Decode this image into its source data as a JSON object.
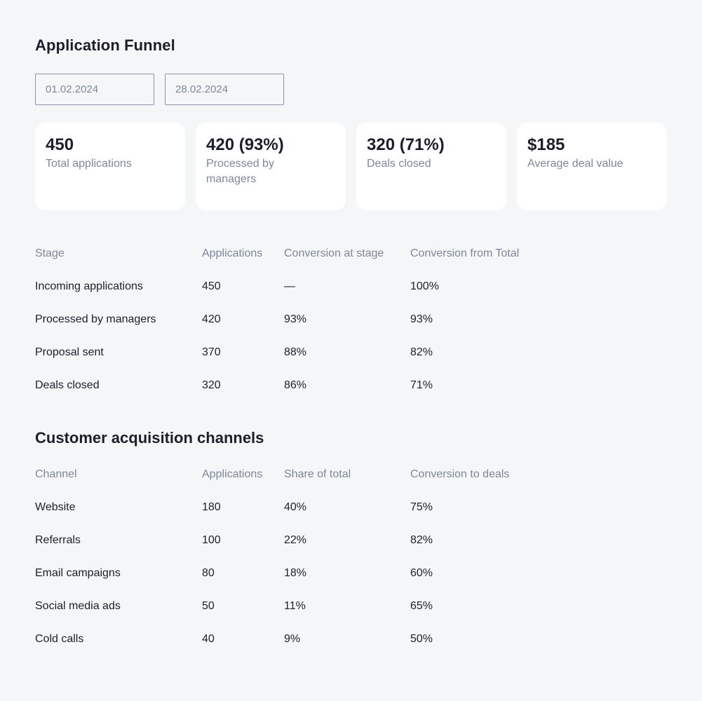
{
  "page": {
    "title": "Application Funnel",
    "date_from": "01.02.2024",
    "date_to": "28.02.2024"
  },
  "cards": [
    {
      "value": "450",
      "label": "Total applications"
    },
    {
      "value": "420 (93%)",
      "label": "Processed by managers"
    },
    {
      "value": "320 (71%)",
      "label": "Deals closed"
    },
    {
      "value": "$185",
      "label": "Average deal value"
    }
  ],
  "funnel": {
    "headers": [
      "Stage",
      "Applications",
      "Conversion at stage",
      "Conversion from Total"
    ],
    "rows": [
      [
        "Incoming applications",
        "450",
        "—",
        "100%"
      ],
      [
        "Processed by managers",
        "420",
        "93%",
        "93%"
      ],
      [
        "Proposal sent",
        "370",
        "88%",
        "82%"
      ],
      [
        "Deals closed",
        "320",
        "86%",
        "71%"
      ]
    ]
  },
  "channels": {
    "title": "Customer acquisition channels",
    "headers": [
      "Channel",
      "Applications",
      "Share of total",
      "Conversion to deals"
    ],
    "rows": [
      [
        "Website",
        "180",
        "40%",
        "75%"
      ],
      [
        "Referrals",
        "100",
        "22%",
        "82%"
      ],
      [
        "Email campaigns",
        "80",
        "18%",
        "60%"
      ],
      [
        "Social media ads",
        "50",
        "11%",
        "65%"
      ],
      [
        "Cold calls",
        "40",
        "9%",
        "50%"
      ]
    ]
  }
}
